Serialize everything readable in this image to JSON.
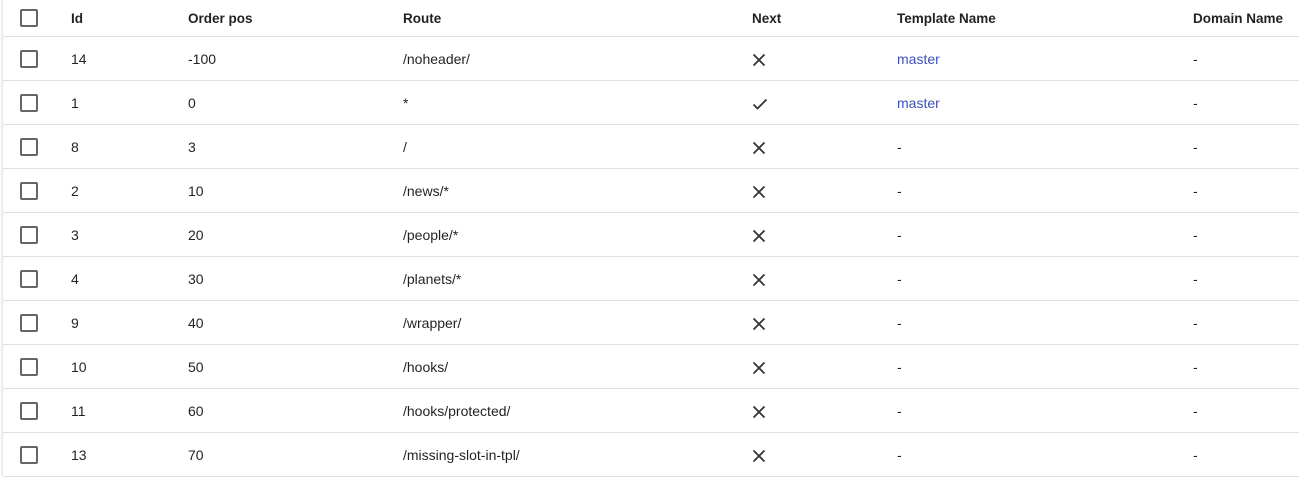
{
  "columns": [
    "Id",
    "Order pos",
    "Route",
    "Next",
    "Template Name",
    "Domain Name"
  ],
  "colors": {
    "link": "#3f51b5"
  },
  "rows": [
    {
      "id": "14",
      "order_pos": "-100",
      "route": "/noheader/",
      "next": "close-icon",
      "template": "master",
      "domain": "-"
    },
    {
      "id": "1",
      "order_pos": "0",
      "route": "*",
      "next": "check-icon",
      "template": "master",
      "domain": "-"
    },
    {
      "id": "8",
      "order_pos": "3",
      "route": "/",
      "next": "close-icon",
      "template": "-",
      "domain": "-"
    },
    {
      "id": "2",
      "order_pos": "10",
      "route": "/news/*",
      "next": "close-icon",
      "template": "-",
      "domain": "-"
    },
    {
      "id": "3",
      "order_pos": "20",
      "route": "/people/*",
      "next": "close-icon",
      "template": "-",
      "domain": "-"
    },
    {
      "id": "4",
      "order_pos": "30",
      "route": "/planets/*",
      "next": "close-icon",
      "template": "-",
      "domain": "-"
    },
    {
      "id": "9",
      "order_pos": "40",
      "route": "/wrapper/",
      "next": "close-icon",
      "template": "-",
      "domain": "-"
    },
    {
      "id": "10",
      "order_pos": "50",
      "route": "/hooks/",
      "next": "close-icon",
      "template": "-",
      "domain": "-"
    },
    {
      "id": "11",
      "order_pos": "60",
      "route": "/hooks/protected/",
      "next": "close-icon",
      "template": "-",
      "domain": "-"
    },
    {
      "id": "13",
      "order_pos": "70",
      "route": "/missing-slot-in-tpl/",
      "next": "close-icon",
      "template": "-",
      "domain": "-"
    }
  ]
}
